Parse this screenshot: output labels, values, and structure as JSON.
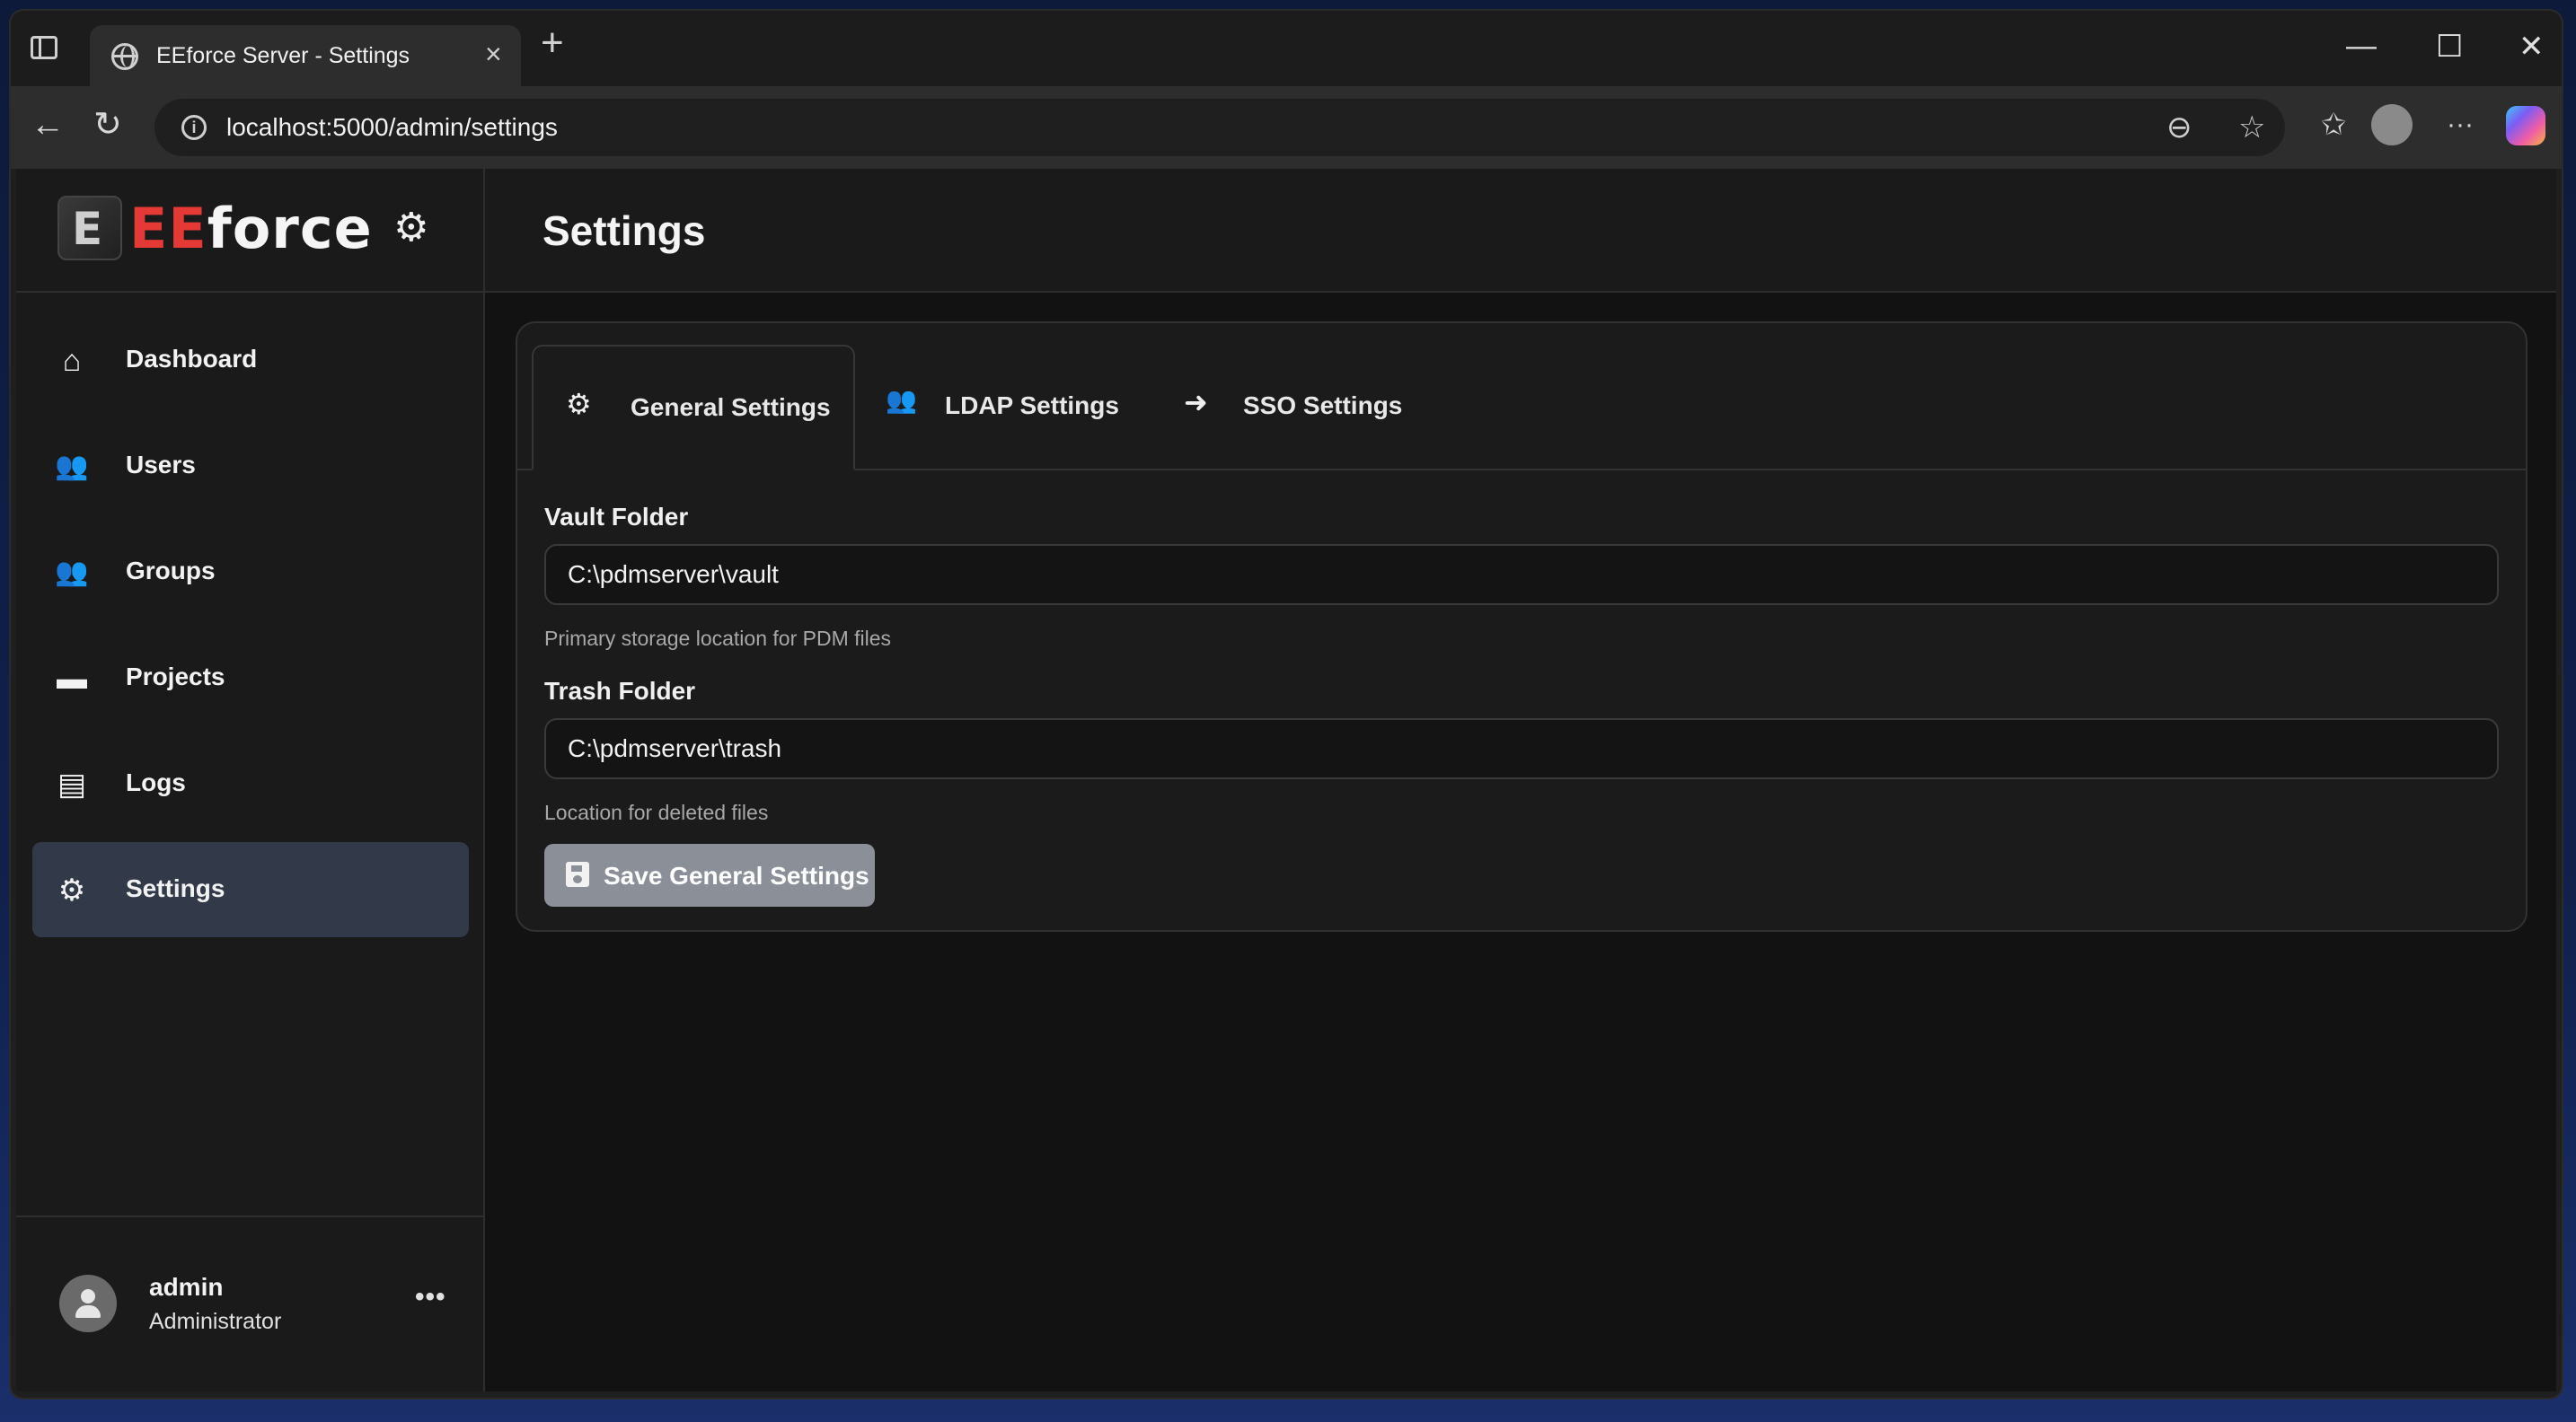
{
  "browser": {
    "tab_title": "EEforce Server - Settings",
    "tab_close": "×",
    "new_tab": "+",
    "url": "localhost:5000/admin/settings",
    "window_controls": {
      "minimize": "—",
      "maximize": "☐",
      "close": "✕"
    },
    "nav": {
      "back": "←",
      "reload": "↻",
      "more": "···"
    },
    "addr_icons": {
      "info": "i",
      "read_aloud": "⊖",
      "favorite": "☆",
      "favorites_hub": "✩"
    }
  },
  "brand": {
    "logo_ee": "EE",
    "logo_force": "force",
    "gear": "⚙"
  },
  "sidebar": {
    "items": [
      {
        "label": "Dashboard",
        "icon": "home-icon",
        "glyph": "⌂",
        "active": false
      },
      {
        "label": "Users",
        "icon": "users-icon",
        "glyph": "👥",
        "active": false
      },
      {
        "label": "Groups",
        "icon": "groups-icon",
        "glyph": "👥",
        "active": false
      },
      {
        "label": "Projects",
        "icon": "folder-icon",
        "glyph": "▬",
        "active": false
      },
      {
        "label": "Logs",
        "icon": "file-icon",
        "glyph": "▤",
        "active": false
      },
      {
        "label": "Settings",
        "icon": "gear-icon",
        "glyph": "⚙",
        "active": true
      }
    ],
    "user": {
      "name": "admin",
      "role": "Administrator",
      "more": "•••"
    }
  },
  "header": {
    "title": "Settings"
  },
  "settings": {
    "tabs": [
      {
        "label": "General Settings",
        "icon": "gear-icon",
        "glyph": "⚙",
        "active": true
      },
      {
        "label": "LDAP Settings",
        "icon": "users-icon",
        "glyph": "👥",
        "active": false
      },
      {
        "label": "SSO Settings",
        "icon": "sign-in-icon",
        "glyph": "➜",
        "active": false
      }
    ],
    "vault": {
      "label": "Vault Folder",
      "value": "C:\\pdmserver\\vault",
      "help": "Primary storage location for PDM files"
    },
    "trash": {
      "label": "Trash Folder",
      "value": "C:\\pdmserver\\trash",
      "help": "Location for deleted files"
    },
    "save_label": "Save General Settings"
  },
  "colors": {
    "accent_red": "#e53935",
    "active_nav_bg": "#323a4a",
    "save_button_bg": "#8a8f98"
  }
}
